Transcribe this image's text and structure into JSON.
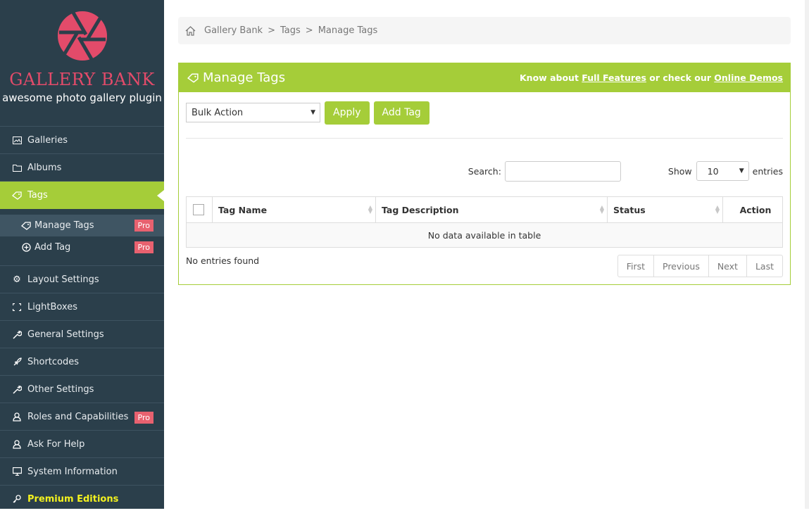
{
  "sidebar": {
    "brand": "GALLERY BANK",
    "tagline": "awesome photo gallery plugin",
    "items": [
      {
        "label": "Galleries",
        "icon": "image-icon"
      },
      {
        "label": "Albums",
        "icon": "folder-icon"
      },
      {
        "label": "Tags",
        "icon": "tag-icon",
        "active": true
      },
      {
        "label": "Layout Settings",
        "icon": "gear-icon"
      },
      {
        "label": "LightBoxes",
        "icon": "fullscreen-icon"
      },
      {
        "label": "General Settings",
        "icon": "wrench-icon"
      },
      {
        "label": "Shortcodes",
        "icon": "rocket-icon"
      },
      {
        "label": "Other Settings",
        "icon": "wrench-icon"
      },
      {
        "label": "Roles and Capabilities",
        "icon": "users-icon",
        "badge": "Pro"
      },
      {
        "label": "Ask For Help",
        "icon": "users-icon"
      },
      {
        "label": "System Information",
        "icon": "monitor-icon"
      },
      {
        "label": "Premium Editions",
        "icon": "key-icon"
      }
    ],
    "subitems": [
      {
        "label": "Manage Tags",
        "icon": "tag-icon",
        "badge": "Pro",
        "current": true
      },
      {
        "label": "Add Tag",
        "icon": "plus-circle-icon",
        "badge": "Pro"
      }
    ]
  },
  "breadcrumb": {
    "items": [
      "Gallery Bank",
      "Tags",
      "Manage Tags"
    ],
    "separator": ">"
  },
  "panel": {
    "title": "Manage Tags",
    "links_prefix": "Know about",
    "link1": "Full Features",
    "links_middle": "or check our",
    "link2": "Online Demos"
  },
  "toolbar": {
    "bulk_action": "Bulk Action",
    "apply": "Apply",
    "add_tag": "Add Tag"
  },
  "table_controls": {
    "search_label": "Search:",
    "search_value": "",
    "show_label": "Show",
    "entries_value": "10",
    "entries_label": "entries"
  },
  "table": {
    "columns": [
      "Tag Name",
      "Tag Description",
      "Status",
      "Action"
    ],
    "empty_message": "No data available in table",
    "info": "No entries found"
  },
  "pagination": {
    "first": "First",
    "previous": "Previous",
    "next": "Next",
    "last": "Last"
  },
  "colors": {
    "accent": "#a5cd39",
    "sidebar": "#2b3f4b",
    "brand": "#e34b6a",
    "pro_badge": "#e8616f",
    "premium": "#f3f11f"
  }
}
